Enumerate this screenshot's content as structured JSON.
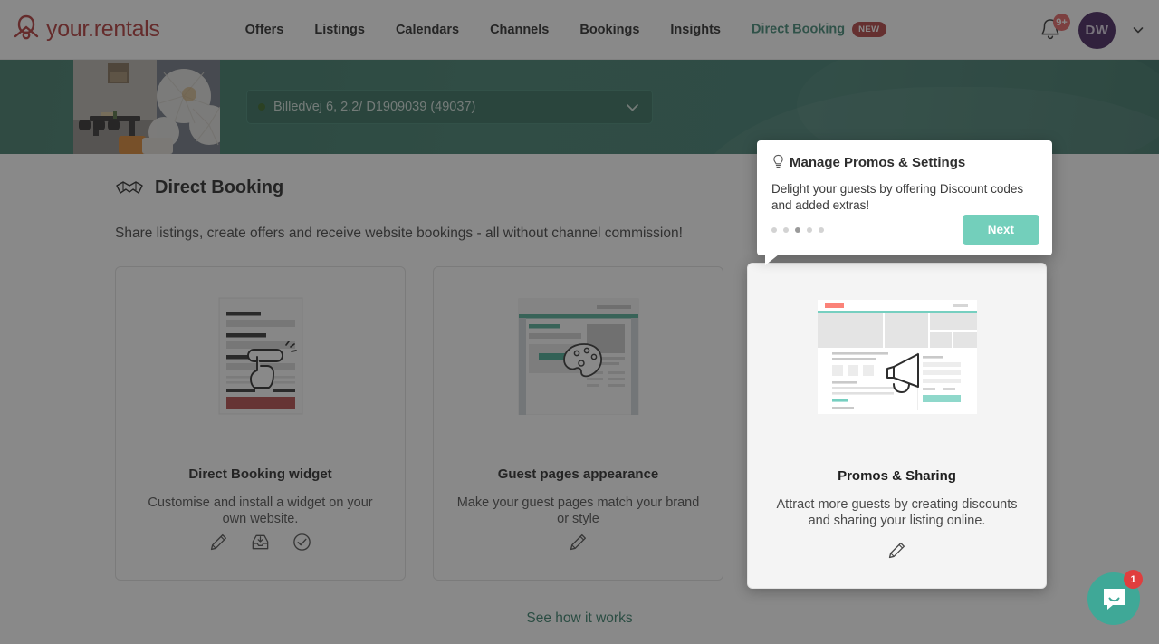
{
  "brand": {
    "name": "your.rentals",
    "logo_icon": "yourrentals-logo-icon"
  },
  "nav": {
    "items": [
      {
        "label": "Offers",
        "active": false
      },
      {
        "label": "Listings",
        "active": false
      },
      {
        "label": "Calendars",
        "active": false
      },
      {
        "label": "Channels",
        "active": false
      },
      {
        "label": "Bookings",
        "active": false
      },
      {
        "label": "Insights",
        "active": false
      },
      {
        "label": "Direct Booking",
        "active": true,
        "badge": "NEW"
      }
    ],
    "notifications": {
      "icon": "bell-icon",
      "count": "9+"
    },
    "avatar": {
      "initials": "DW",
      "caret_icon": "chevron-down-icon"
    }
  },
  "hero": {
    "property_select": {
      "value": "Billedvej 6, 2.2/ D1909039 (49037)",
      "status_dot_color": "#2f5f1e",
      "caret_icon": "chevron-down-icon"
    },
    "photo_alt": "property-thumbnail"
  },
  "page": {
    "icon": "handshake-icon",
    "title": "Direct Booking",
    "subtitle": "Share listings, create offers and receive website bookings - all without channel commission!",
    "footer_link": "See how it works"
  },
  "cards": [
    {
      "title": "Direct Booking widget",
      "description": "Customise and install a widget on your own website.",
      "illustration": "widget-form-illustration",
      "actions": [
        "pencil-icon",
        "install-inbox-icon",
        "check-circle-icon"
      ],
      "highlighted": false
    },
    {
      "title": "Guest pages appearance",
      "description": "Make your guest pages match your brand or style",
      "illustration": "palette-page-illustration",
      "actions": [
        "pencil-icon"
      ],
      "highlighted": false
    },
    {
      "title": "Promos & Sharing",
      "description": "Attract more guests by creating discounts and sharing your listing online.",
      "illustration": "megaphone-page-illustration",
      "actions": [
        "pencil-icon"
      ],
      "highlighted": true
    }
  ],
  "tour": {
    "icon": "lightbulb-icon",
    "title": "Manage Promos & Settings",
    "body": "Delight your guests by offering Discount codes and added extras!",
    "next_label": "Next",
    "step_count": 5,
    "active_step": 3
  },
  "chat": {
    "icon": "chat-bubble-icon",
    "unread": "1"
  },
  "colors": {
    "brand_red": "#b03232",
    "hero_green": "#35745f",
    "accent_teal": "#3b8571",
    "mint_button": "#73cfbb",
    "badge_red": "#e03e3e",
    "avatar_purple": "#3d1a57"
  }
}
